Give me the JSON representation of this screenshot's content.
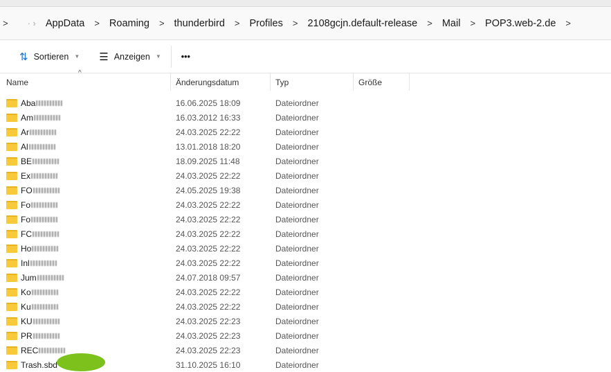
{
  "breadcrumb": [
    "AppData",
    "Roaming",
    "thunderbird",
    "Profiles",
    "2108gcjn.default-release",
    "Mail",
    "POP3.web-2.de"
  ],
  "toolbar": {
    "sort": "Sortieren",
    "view": "Anzeigen",
    "more": "•••"
  },
  "columns": {
    "name": "Name",
    "date": "Änderungsdatum",
    "type": "Typ",
    "size": "Größe"
  },
  "rows": [
    {
      "name": "Aba",
      "date": "16.06.2025 18:09",
      "type": "Dateiordner"
    },
    {
      "name": "Am",
      "date": "16.03.2012 16:33",
      "type": "Dateiordner"
    },
    {
      "name": "Ar",
      "date": "24.03.2025 22:22",
      "type": "Dateiordner"
    },
    {
      "name": "Al",
      "date": "13.01.2018 18:20",
      "type": "Dateiordner"
    },
    {
      "name": "BE",
      "date": "18.09.2025 11:48",
      "type": "Dateiordner"
    },
    {
      "name": "Ex",
      "date": "24.03.2025 22:22",
      "type": "Dateiordner"
    },
    {
      "name": "FO",
      "date": "24.05.2025 19:38",
      "type": "Dateiordner"
    },
    {
      "name": "Fo",
      "date": "24.03.2025 22:22",
      "type": "Dateiordner"
    },
    {
      "name": "Fo",
      "date": "24.03.2025 22:22",
      "type": "Dateiordner"
    },
    {
      "name": "FC",
      "date": "24.03.2025 22:22",
      "type": "Dateiordner"
    },
    {
      "name": "Ho",
      "date": "24.03.2025 22:22",
      "type": "Dateiordner"
    },
    {
      "name": "Inl",
      "date": "24.03.2025 22:22",
      "type": "Dateiordner"
    },
    {
      "name": "Jum",
      "date": "24.07.2018 09:57",
      "type": "Dateiordner"
    },
    {
      "name": "Ko",
      "date": "24.03.2025 22:22",
      "type": "Dateiordner"
    },
    {
      "name": "Ku",
      "date": "24.03.2025 22:22",
      "type": "Dateiordner"
    },
    {
      "name": "KU",
      "date": "24.03.2025 22:23",
      "type": "Dateiordner"
    },
    {
      "name": "PR",
      "date": "24.03.2025 22:23",
      "type": "Dateiordner"
    },
    {
      "name": "REC",
      "date": "24.03.2025 22:23",
      "type": "Dateiordner"
    },
    {
      "name": "Trash.sbd",
      "date": "31.10.2025 16:10",
      "type": "Dateiordner"
    }
  ]
}
